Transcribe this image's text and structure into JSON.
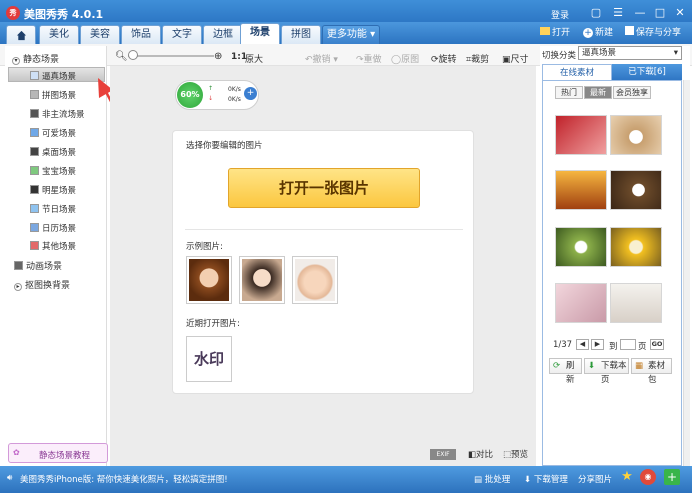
{
  "app": {
    "title": "美图秀秀 4.0.1",
    "logo_text": "秀"
  },
  "window": {
    "login": "登录",
    "msg": "▢",
    "menu": "☰",
    "minimize": "—",
    "maximize": "□",
    "close": "✕"
  },
  "tabs": [
    {
      "label": "美化"
    },
    {
      "label": "美容"
    },
    {
      "label": "饰品"
    },
    {
      "label": "文字"
    },
    {
      "label": "边框"
    },
    {
      "label": "场景"
    },
    {
      "label": "拼图"
    },
    {
      "label": "更多功能 ▾"
    }
  ],
  "top_actions": {
    "open": "打开",
    "new": "新建",
    "save": "保存与分享"
  },
  "toolbar": {
    "zoom_reset": "1:1",
    "original": "原大",
    "undo": "撤销",
    "redo": "重做",
    "restore": "原图",
    "rotate": "旋转",
    "crop": "裁剪",
    "size": "尺寸"
  },
  "sidebar": {
    "static_scenes": "静态场景",
    "items": [
      {
        "label": "逼真场景"
      },
      {
        "label": "拼图场景"
      },
      {
        "label": "非主流场景"
      },
      {
        "label": "可爱场景"
      },
      {
        "label": "桌面场景"
      },
      {
        "label": "宝宝场景"
      },
      {
        "label": "明星场景"
      },
      {
        "label": "节日场景"
      },
      {
        "label": "日历场景"
      },
      {
        "label": "其他场景"
      }
    ],
    "animated_scenes": "动画场景",
    "cutout_background": "抠图换背景",
    "tutorial": "静态场景教程"
  },
  "speed": {
    "percent": "60%",
    "up": "0K/s",
    "down": "0K/s"
  },
  "card": {
    "prompt": "选择你要编辑的图片",
    "open_button": "打开一张图片",
    "examples_label": "示例图片:",
    "recent_label": "近期打开图片:",
    "recent_item": "水印"
  },
  "right": {
    "category_label": "切换分类",
    "category_value": "逼真场景",
    "tab_online": "在线素材",
    "tab_downloaded": "已下载[6]",
    "filters": [
      "热门",
      "最新",
      "会员独享"
    ],
    "page_current": "1/37",
    "page_to": "到",
    "page_unit": "页",
    "go": "GO",
    "refresh": "刷新",
    "download_page": "下载本页",
    "library": "素材包"
  },
  "bottom_controls": {
    "exif": "EXIF",
    "compare": "对比",
    "preview": "预览"
  },
  "status": {
    "info": "美图秀秀iPhone版: 帮你快速美化照片，轻松搞定拼图!",
    "batch": "批处理",
    "download_manager": "下载管理",
    "share_image": "分享图片"
  },
  "colors": {
    "accent": "#2f76c4",
    "button": "#fbc73f",
    "tutorial": "#d39ad9"
  }
}
